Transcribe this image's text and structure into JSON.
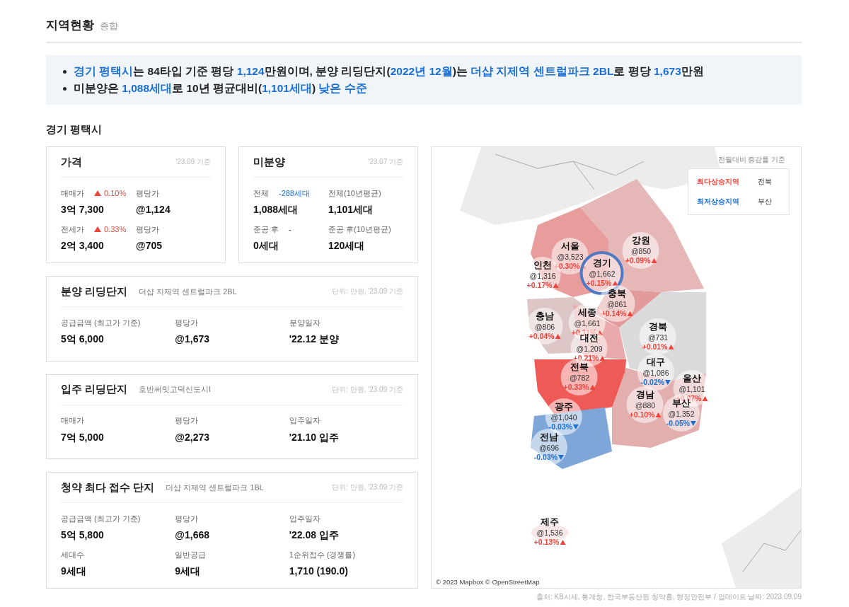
{
  "header": {
    "title": "지역현황",
    "subtitle": "종합"
  },
  "summary": [
    [
      {
        "text": "경기 평택시",
        "highlight": true
      },
      {
        "text": "는 84타입 기준 평당 ",
        "highlight": false
      },
      {
        "text": "1,124",
        "highlight": true
      },
      {
        "text": "만원이며, 분양 리딩단지(",
        "highlight": false
      },
      {
        "text": "2022년 12월",
        "highlight": true
      },
      {
        "text": ")는 ",
        "highlight": false
      },
      {
        "text": "더샵 지제역 센트럴파크 2BL",
        "highlight": true
      },
      {
        "text": "로 평당 ",
        "highlight": false
      },
      {
        "text": "1,673",
        "highlight": true
      },
      {
        "text": "만원",
        "highlight": false
      }
    ],
    [
      {
        "text": "미분양은 ",
        "highlight": false
      },
      {
        "text": "1,088세대",
        "highlight": true
      },
      {
        "text": "로 10년 평균대비(",
        "highlight": false
      },
      {
        "text": "1,101세대",
        "highlight": true
      },
      {
        "text": ") ",
        "highlight": false
      },
      {
        "text": "낮은 수준",
        "highlight": true
      }
    ]
  ],
  "section_title": "경기 평택시",
  "cards": [
    {
      "kind": "half",
      "title": "가격",
      "note": "'23.09 기준",
      "items": [
        {
          "label": "매매가",
          "change": "0.10%",
          "rising": true,
          "arrow": true,
          "value": "3억 7,300"
        },
        {
          "label": "평당가",
          "value": "@1,124"
        },
        {
          "label": "전세가",
          "change": "0.33%",
          "rising": true,
          "arrow": true,
          "value": "2억 3,400"
        },
        {
          "label": "평당가",
          "value": "@705"
        }
      ]
    },
    {
      "kind": "half",
      "title": "미분양",
      "note": "'23.07 기준",
      "items": [
        {
          "label": "전체",
          "change": "-288세대",
          "rising": false,
          "arrow": false,
          "value": "1,088세대"
        },
        {
          "label": "전체(10년평균)",
          "value": "1,101세대"
        },
        {
          "label": "준공 후",
          "change": "-",
          "value": "0세대"
        },
        {
          "label": "준공 후(10년평균)",
          "value": "120세대"
        }
      ]
    },
    {
      "kind": "wide",
      "title": "분양 리딩단지",
      "subtitle": "더샵 지제역 센트럴파크 2BL",
      "note": "단위: 만원, '23.09 기준",
      "items": [
        {
          "label": "공급금액 (최고가 기준)",
          "value": "5억 6,000"
        },
        {
          "label": "평당가",
          "value": "@1,673"
        },
        {
          "label": "분양일자",
          "value": "'22.12 분양"
        }
      ]
    },
    {
      "kind": "wide",
      "title": "입주 리딩단지",
      "subtitle": "호반써밋고덕신도시I",
      "note": "단위: 만원, '23.09 기준",
      "items": [
        {
          "label": "매매가",
          "value": "7억 5,000"
        },
        {
          "label": "평당가",
          "value": "@2,273"
        },
        {
          "label": "입주일자",
          "value": "'21.10 입주"
        }
      ]
    },
    {
      "kind": "wide",
      "title": "청약 최다 접수 단지",
      "subtitle": "더샵 지제역 센트럴파크 1BL",
      "note": "단위: 만원, '23.09 기준",
      "items": [
        {
          "label": "공급금액 (최고가 기준)",
          "value": "5억 5,800"
        },
        {
          "label": "평당가",
          "value": "@1,668"
        },
        {
          "label": "입주일자",
          "value": "'22.08 입주"
        },
        {
          "label": "세대수",
          "value": "9세대"
        },
        {
          "label": "일반공급",
          "value": "9세대"
        },
        {
          "label": "1순위접수 (경쟁률)",
          "value": "1,710 (190.0)"
        }
      ]
    }
  ],
  "map": {
    "legend_note": "전월대비 증감률 기준",
    "legend": [
      {
        "label": "최다상승지역",
        "value": "전북",
        "rising": true
      },
      {
        "label": "최저상승지역",
        "value": "부산",
        "rising": false
      }
    ],
    "markers": [
      {
        "name": "서울",
        "price": "@3,523",
        "change": "+0.30%",
        "rising": true,
        "selected": false
      },
      {
        "name": "강원",
        "price": "@850",
        "change": "+0.09%",
        "rising": true,
        "selected": false
      },
      {
        "name": "인천",
        "price": "@1,316",
        "change": "+0.17%",
        "rising": true,
        "selected": false
      },
      {
        "name": "경기",
        "price": "@1,662",
        "change": "+0.15%",
        "rising": true,
        "selected": true
      },
      {
        "name": "충북",
        "price": "@861",
        "change": "+0.14%",
        "rising": true,
        "selected": false
      },
      {
        "name": "충남",
        "price": "@806",
        "change": "+0.04%",
        "rising": true,
        "selected": false
      },
      {
        "name": "세종",
        "price": "@1,661",
        "change": "+0.11%",
        "rising": true,
        "selected": false
      },
      {
        "name": "경북",
        "price": "@731",
        "change": "+0.01%",
        "rising": true,
        "selected": false
      },
      {
        "name": "대전",
        "price": "@1,209",
        "change": "+0.21%",
        "rising": true,
        "selected": false
      },
      {
        "name": "전북",
        "price": "@782",
        "change": "+0.33%",
        "rising": true,
        "selected": false
      },
      {
        "name": "대구",
        "price": "@1,086",
        "change": "-0.02%",
        "rising": false,
        "selected": false
      },
      {
        "name": "울산",
        "price": "@1,101",
        "change": "+0.07%",
        "rising": true,
        "selected": false
      },
      {
        "name": "광주",
        "price": "@1,040",
        "change": "-0.03%",
        "rising": false,
        "selected": false
      },
      {
        "name": "경남",
        "price": "@880",
        "change": "+0.10%",
        "rising": true,
        "selected": false
      },
      {
        "name": "부산",
        "price": "@1,352",
        "change": "-0.05%",
        "rising": false,
        "selected": false
      },
      {
        "name": "전남",
        "price": "@696",
        "change": "-0.03%",
        "rising": false,
        "selected": false
      },
      {
        "name": "제주",
        "price": "@1,536",
        "change": "+0.13%",
        "rising": true,
        "selected": false
      }
    ],
    "attribution": "© 2023 Mapbox © OpenStreetMap"
  },
  "source": "출처: KB시세, 통계청, 한국부동산원 청약홈, 행정안전부 / 업데이트 날짜: 2023.09.09"
}
